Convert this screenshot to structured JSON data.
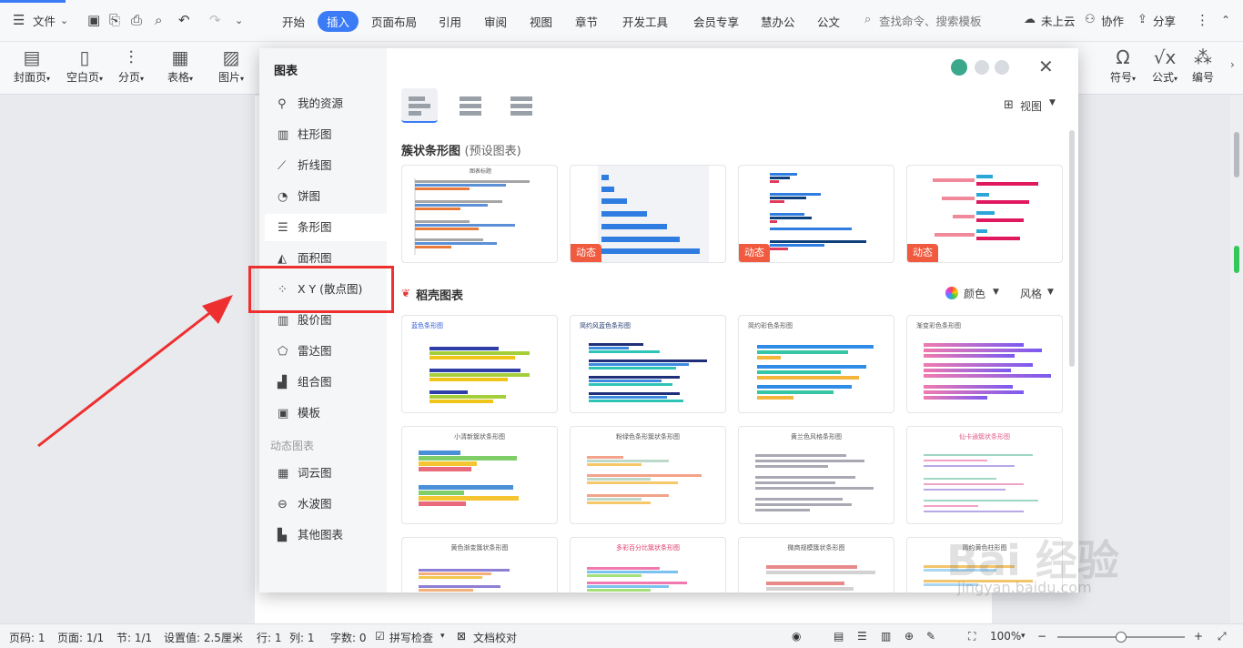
{
  "topbar": {
    "file_menu": "文件",
    "tabs": [
      "开始",
      "插入",
      "页面布局",
      "引用",
      "审阅",
      "视图",
      "章节",
      "开发工具",
      "会员专享",
      "慧办公",
      "公文"
    ],
    "active_tab": "插入",
    "search_placeholder": "查找命令、搜索模板",
    "cloud": "未上云",
    "collab": "协作",
    "share": "分享"
  },
  "ribbon": {
    "buttons": [
      {
        "label": "封面页",
        "icon": "cover-page-icon"
      },
      {
        "label": "空白页",
        "icon": "blank-page-icon"
      },
      {
        "label": "分页",
        "icon": "page-break-icon"
      },
      {
        "label": "表格",
        "icon": "table-icon"
      },
      {
        "label": "图片",
        "icon": "picture-icon"
      },
      {
        "label": "符号",
        "icon": "omega-icon"
      },
      {
        "label": "公式",
        "icon": "formula-icon"
      },
      {
        "label": "编号",
        "icon": "numbering-icon"
      }
    ]
  },
  "dialog": {
    "title": "图表",
    "sidebar": [
      {
        "label": "我的资源",
        "icon": "person-icon"
      },
      {
        "label": "柱形图",
        "icon": "column-chart-icon"
      },
      {
        "label": "折线图",
        "icon": "line-chart-icon"
      },
      {
        "label": "饼图",
        "icon": "pie-chart-icon"
      },
      {
        "label": "条形图",
        "icon": "bar-chart-icon"
      },
      {
        "label": "面积图",
        "icon": "area-chart-icon"
      },
      {
        "label": "X Y (散点图)",
        "icon": "scatter-chart-icon"
      },
      {
        "label": "股价图",
        "icon": "stock-chart-icon"
      },
      {
        "label": "雷达图",
        "icon": "radar-chart-icon"
      },
      {
        "label": "组合图",
        "icon": "combo-chart-icon"
      },
      {
        "label": "模板",
        "icon": "template-icon"
      }
    ],
    "dynamic_section": "动态图表",
    "dynamic_items": [
      {
        "label": "词云图",
        "icon": "word-cloud-icon"
      },
      {
        "label": "水波图",
        "icon": "water-wave-icon"
      },
      {
        "label": "其他图表",
        "icon": "other-chart-icon"
      }
    ],
    "view_label": "视图",
    "preset_title": "簇状条形图",
    "preset_sub": "(预设图表)",
    "badge_label": "动态",
    "daoke_title": "稻壳图表",
    "color_label": "颜色",
    "style_label": "风格",
    "card_titles": [
      "蓝色条形图",
      "简约风蓝色条形图",
      "简约彩色条形图",
      "渐变彩色条形图",
      "小清新簇状条形图",
      "粉绿色条形簇状条形图",
      "黄兰色风格条形图",
      "仙卡通簇状条形图",
      "黄色渐变簇状条形图",
      "多彩百分比簇状条形图",
      "微商规模簇状条形图",
      "简约黄色柱形图"
    ]
  },
  "statusbar": {
    "page_code": "页码: 1",
    "page": "页面: 1/1",
    "section": "节: 1/1",
    "setting": "设置值: 2.5厘米",
    "row": "行: 1",
    "col": "列: 1",
    "words": "字数: 0",
    "spell": "拼写检查",
    "doc_check": "文档校对",
    "zoom": "100%"
  },
  "watermark": {
    "brand": "Bai 经验",
    "url": "jingyan.baidu.com"
  }
}
